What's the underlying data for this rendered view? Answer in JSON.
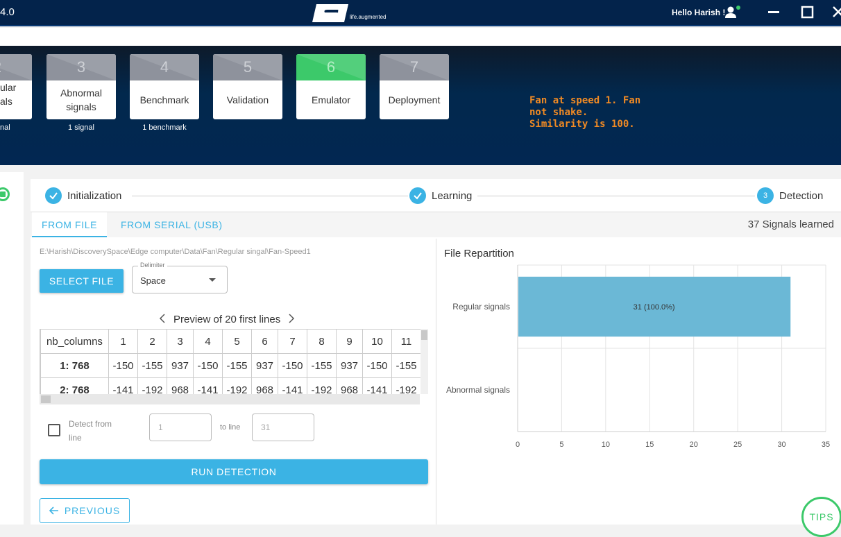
{
  "app": {
    "version_fragment": "4.0",
    "logo_tagline": "life.augmented",
    "greeting": "Hello Harish !"
  },
  "workflow_steps": [
    {
      "number": "2",
      "label_lines": [
        "ular",
        "als"
      ],
      "sub": "nal"
    },
    {
      "number": "3",
      "label_lines": [
        "Abnormal",
        "signals"
      ],
      "sub": "1 signal"
    },
    {
      "number": "4",
      "label_lines": [
        "Benchmark"
      ],
      "sub": "1 benchmark"
    },
    {
      "number": "5",
      "label_lines": [
        "Validation"
      ],
      "sub": ""
    },
    {
      "number": "6",
      "label_lines": [
        "Emulator"
      ],
      "sub": ""
    },
    {
      "number": "7",
      "label_lines": [
        "Deployment"
      ],
      "sub": ""
    }
  ],
  "emulator_message": "Fan at speed 1. Fan\nnot shake.\nSimilarity is 100.",
  "stepper": {
    "items": [
      {
        "label": "Initialization",
        "state": "done"
      },
      {
        "label": "Learning",
        "state": "done"
      },
      {
        "label": "Detection",
        "state": "active",
        "number": "3"
      }
    ]
  },
  "tabs": {
    "from_file": "FROM FILE",
    "from_serial": "FROM SERIAL (USB)",
    "learned": "37 Signals learned"
  },
  "file": {
    "path": "E:\\Harish\\DiscoverySpace\\Edge computer\\Data\\Fan\\Regular singal\\Fan-Speed1",
    "select_label": "SELECT FILE",
    "delimiter_label": "Delimiter",
    "delimiter_value": "Space"
  },
  "preview": {
    "title": "Preview of 20 first lines",
    "header": [
      "nb_columns",
      "1",
      "2",
      "3",
      "4",
      "5",
      "6",
      "7",
      "8",
      "9",
      "10",
      "11"
    ],
    "rows": [
      [
        "1: 768",
        "-150",
        "-155",
        "937",
        "-150",
        "-155",
        "937",
        "-150",
        "-155",
        "937",
        "-150",
        "-155"
      ],
      [
        "2: 768",
        "-141",
        "-192",
        "968",
        "-141",
        "-192",
        "968",
        "-141",
        "-192",
        "968",
        "-141",
        "-192"
      ]
    ]
  },
  "detect": {
    "checkbox_label": "Detect from line",
    "from_placeholder": "1",
    "to_label": "to line",
    "to_placeholder": "31",
    "run_label": "RUN DETECTION",
    "previous_label": "PREVIOUS"
  },
  "chart_data": {
    "type": "bar",
    "orientation": "horizontal",
    "title": "File Repartition",
    "categories": [
      "Regular signals",
      "Abnormal signals"
    ],
    "values": [
      31,
      0
    ],
    "data_labels": [
      "31 (100.0%)",
      ""
    ],
    "xlim": [
      0,
      35
    ],
    "x_ticks": [
      "0",
      "5",
      "10",
      "15",
      "20",
      "25",
      "30",
      "35"
    ],
    "grid": true,
    "bar_color": "#6bb8d6"
  },
  "tips_label": "TIPS",
  "colors": {
    "accent": "#3bb3e4",
    "success": "#3cc96a",
    "header_bg": "#03234b",
    "message": "#f08a24"
  }
}
